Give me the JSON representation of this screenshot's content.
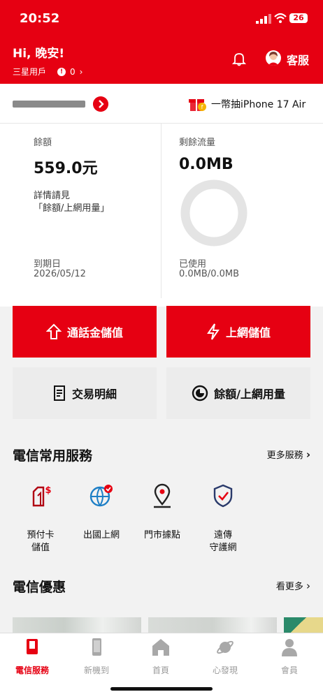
{
  "status": {
    "time": "20:52",
    "battery": "26"
  },
  "header": {
    "greeting": "Hi, 晚安!",
    "user_type": "三星用戶",
    "points": "0",
    "customer_service": "客服"
  },
  "account": {
    "promo": "一幣抽iPhone 17 Air"
  },
  "balance": {
    "label": "餘額",
    "amount": "559.0元",
    "note_line1": "詳情請見",
    "note_line2": "「餘額/上網用量」",
    "expiry_label": "到期日",
    "expiry_date": "2026/05/12"
  },
  "data_usage": {
    "label": "剩餘流量",
    "remaining": "0.0MB",
    "used_label": "已使用",
    "used_value": "0.0MB/0.0MB",
    "used_fraction": 0
  },
  "actions": {
    "topup_call": "通話金儲值",
    "topup_data": "上網儲值",
    "transactions": "交易明細",
    "usage": "餘額/上網用量"
  },
  "services": {
    "title": "電信常用服務",
    "more": "更多服務",
    "items": [
      {
        "label1": "預付卡",
        "label2": "儲值",
        "icon": "prepaid-card-icon"
      },
      {
        "label1": "出國上網",
        "label2": "",
        "icon": "globe-icon"
      },
      {
        "label1": "門市據點",
        "label2": "",
        "icon": "location-pin-icon"
      },
      {
        "label1": "遠傳",
        "label2": "守護網",
        "icon": "shield-check-icon"
      }
    ]
  },
  "offers": {
    "title": "電信優惠",
    "more": "看更多"
  },
  "nav": {
    "items": [
      {
        "label": "電信服務",
        "icon": "phone-card-icon",
        "active": true
      },
      {
        "label": "新機到",
        "icon": "smartphone-icon",
        "active": false
      },
      {
        "label": "首頁",
        "icon": "home-icon",
        "active": false
      },
      {
        "label": "心發現",
        "icon": "planet-icon",
        "active": false
      },
      {
        "label": "會員",
        "icon": "person-icon",
        "active": false
      }
    ]
  },
  "colors": {
    "brand": "#e60012",
    "grey_button": "#ececec"
  }
}
